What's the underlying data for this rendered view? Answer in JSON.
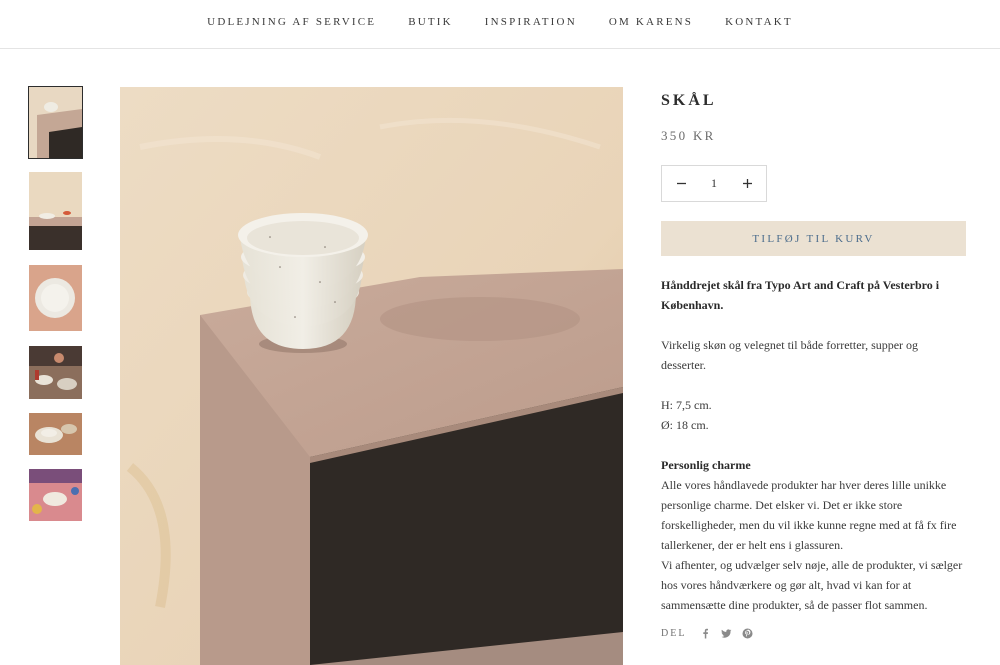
{
  "nav": {
    "items": [
      {
        "label": "UDLEJNING AF SERVICE"
      },
      {
        "label": "BUTIK"
      },
      {
        "label": "INSPIRATION"
      },
      {
        "label": "OM KARENS"
      },
      {
        "label": "KONTAKT"
      }
    ]
  },
  "product": {
    "title": "SKÅL",
    "price": "350 KR",
    "quantity": "1",
    "add_to_cart_label": "TILFØJ TIL KURV",
    "description": {
      "intro": "Hånddrejet skål fra Typo Art and Craft på Vesterbro i København.",
      "usage": "Virkelig skøn og velegnet til både forretter, supper og desserter.",
      "height": "H: 7,5 cm.",
      "diameter": "Ø: 18 cm.",
      "charm_heading": "Personlig charme",
      "charm_text": "Alle vores håndlavede produkter har hver deres lille unikke personlige charme. Det elsker vi. Det er ikke store forskelligheder, men du vil ikke kunne regne med at få fx fire tallerkener, der er helt ens i glassuren.",
      "curation_text": "Vi afhenter, og udvælger selv nøje, alle de produkter, vi sælger hos vores håndværkere og gør alt, hvad vi kan for at sammensætte dine produkter, så de passer flot sammen."
    }
  },
  "share": {
    "label": "DEL",
    "icons": [
      "facebook-icon",
      "twitter-icon",
      "pinterest-icon"
    ]
  },
  "thumbnails": [
    {
      "name": "bowl-stack-thumb",
      "active": true
    },
    {
      "name": "table-setting-thumb",
      "active": false
    },
    {
      "name": "plate-top-view-thumb",
      "active": false
    },
    {
      "name": "dinner-party-thumb",
      "active": false
    },
    {
      "name": "tableware-closeup-thumb",
      "active": false
    },
    {
      "name": "pink-table-thumb",
      "active": false
    }
  ],
  "colors": {
    "accent_button_bg": "#ebe1d2",
    "accent_button_text": "#4b6c8c",
    "text": "#2d2d2d",
    "border": "#e4e4e4"
  }
}
